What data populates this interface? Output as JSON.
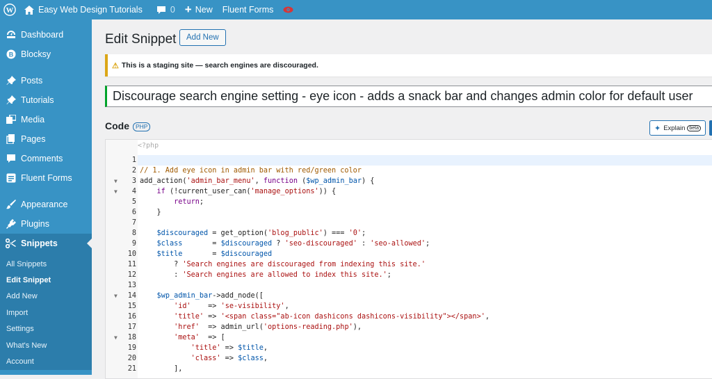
{
  "admin_bar": {
    "site_name": "Easy Web Design Tutorials",
    "comments_count": "0",
    "new_label": "New",
    "fluent_forms": "Fluent Forms"
  },
  "sidebar": {
    "items": [
      {
        "label": "Dashboard",
        "icon": "dashboard-icon"
      },
      {
        "label": "Blocksy",
        "icon": "blocksy-icon"
      },
      {
        "label": "Posts",
        "icon": "pin-icon"
      },
      {
        "label": "Tutorials",
        "icon": "pin-icon"
      },
      {
        "label": "Media",
        "icon": "media-icon"
      },
      {
        "label": "Pages",
        "icon": "pages-icon"
      },
      {
        "label": "Comments",
        "icon": "comment-icon"
      },
      {
        "label": "Fluent Forms",
        "icon": "forms-icon"
      },
      {
        "label": "Appearance",
        "icon": "brush-icon"
      },
      {
        "label": "Plugins",
        "icon": "plugin-icon"
      },
      {
        "label": "Snippets",
        "icon": "scissors-icon"
      }
    ],
    "submenu": [
      "All Snippets",
      "Edit Snippet",
      "Add New",
      "Import",
      "Settings",
      "What's New",
      "Account"
    ]
  },
  "page": {
    "title": "Edit Snippet",
    "add_new": "Add New",
    "notice": "This is a staging site — search engines are discouraged.",
    "snippet_title": "Discourage search engine setting - eye icon - adds a snack bar and changes admin color for default user",
    "code_label": "Code",
    "php_badge": "PHP",
    "explain_label": "Explain",
    "beta_label": "beta"
  },
  "editor": {
    "php_open": "<?php",
    "lines": [
      "1",
      "2",
      "3",
      "4",
      "5",
      "6",
      "7",
      "8",
      "9",
      "10",
      "11",
      "12",
      "13",
      "14",
      "15",
      "16",
      "17",
      "18",
      "19",
      "20",
      "21"
    ]
  }
}
